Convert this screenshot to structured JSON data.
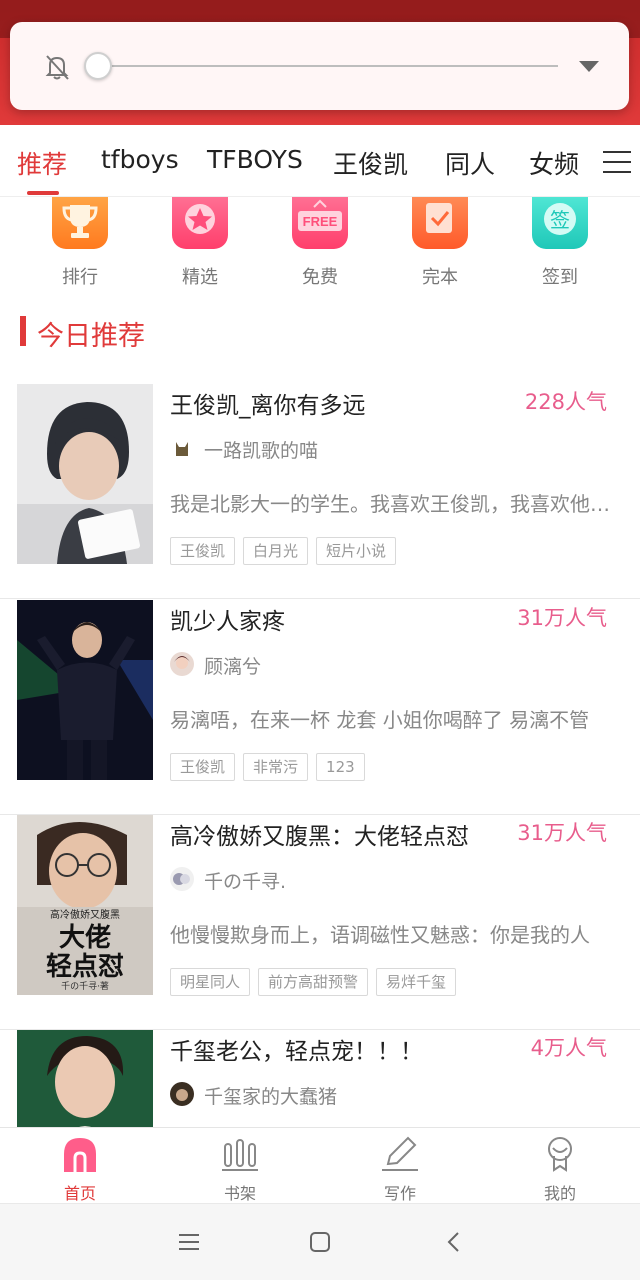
{
  "tabs": [
    {
      "label": "推荐",
      "active": true
    },
    {
      "label": "tfboys"
    },
    {
      "label": "TFBOYS"
    },
    {
      "label": "王俊凯"
    },
    {
      "label": "同人"
    },
    {
      "label": "女频"
    }
  ],
  "quick": [
    {
      "label": "排行",
      "icon": "trophy-icon",
      "color": "#ff8a2b"
    },
    {
      "label": "精选",
      "icon": "star-icon",
      "color": "#ff4f7b"
    },
    {
      "label": "免费",
      "icon": "free-icon",
      "color": "#ff4f7b",
      "text": "FREE"
    },
    {
      "label": "完本",
      "icon": "check-icon",
      "color": "#ff6a3a"
    },
    {
      "label": "签到",
      "icon": "sign-in-icon",
      "color": "#2fd7c5",
      "text": "签"
    }
  ],
  "section": {
    "title": "今日推荐"
  },
  "books": [
    {
      "title": "王俊凯_离你有多远",
      "popularity": "228人气",
      "author": "一路凯歌的喵",
      "desc": "我是北影大一的学生。我喜欢王俊凯，我喜欢他很久了",
      "tags": [
        "王俊凯",
        "白月光",
        "短片小说"
      ]
    },
    {
      "title": "凯少人家疼",
      "popularity": "31万人气",
      "author": "顾漓兮",
      "desc": "易漓唔，在来一杯 龙套 小姐你喝醉了 易漓不管",
      "tags": [
        "王俊凯",
        "非常污",
        "123"
      ]
    },
    {
      "title": "高冷傲娇又腹黑：大佬轻点怼",
      "popularity": "31万人气",
      "author": "千の千寻.",
      "desc": "他慢慢欺身而上，语调磁性又魅惑：你是我的人",
      "tags": [
        "明星同人",
        "前方高甜预警",
        "易烊千玺"
      ],
      "cover_text": [
        "高冷傲娇又腹黑",
        "大佬",
        "轻点怼",
        "千の千寻·著"
      ]
    },
    {
      "title": "千玺老公，轻点宠！！！",
      "popularity": "4万人气",
      "author": "千玺家的大蠢猪",
      "desc": "",
      "tags": []
    }
  ],
  "bottom_nav": [
    {
      "label": "首页",
      "icon": "home-icon",
      "active": true
    },
    {
      "label": "书架",
      "icon": "bookshelf-icon"
    },
    {
      "label": "写作",
      "icon": "pencil-icon"
    },
    {
      "label": "我的",
      "icon": "profile-icon"
    }
  ],
  "colors": {
    "brand": "#e03a3a",
    "popularity": "#e85d8c"
  }
}
